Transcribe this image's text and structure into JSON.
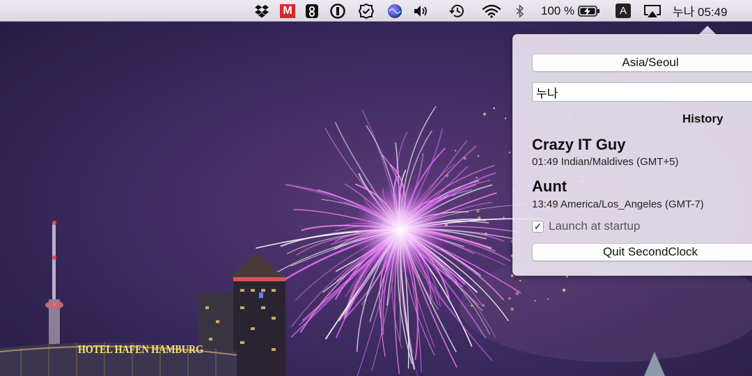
{
  "menubar": {
    "battery_percent": "100 %",
    "input_source_letter": "A",
    "clock_text": "누나 05:49",
    "icons": [
      "dropbox-icon",
      "mega-icon",
      "app-icon",
      "onepassword-icon",
      "tasks-icon",
      "siri-icon",
      "volume-icon",
      "time-machine-icon",
      "wifi-icon",
      "bluetooth-icon",
      "battery-icon",
      "input-source-icon",
      "airplay-icon"
    ]
  },
  "popover": {
    "timezone_button_label": "Asia/Seoul",
    "name_input_value": "누나",
    "history_heading": "History",
    "history": [
      {
        "name": "Crazy IT Guy",
        "detail": "01:49 Indian/Maldives (GMT+5)"
      },
      {
        "name": "Aunt",
        "detail": "13:49 America/Los_Angeles (GMT-7)"
      }
    ],
    "launch_at_startup_label": "Launch at startup",
    "launch_at_startup_checked": true,
    "checkmark": "✓",
    "quit_button_label": "Quit SecondClock"
  },
  "wallpaper": {
    "sign_text": "HOTEL HAFEN HAMBURG"
  },
  "colors": {
    "popover_bg": "#e8e2ee",
    "firework": "#e36bff",
    "sky": "#3a2a5e"
  }
}
